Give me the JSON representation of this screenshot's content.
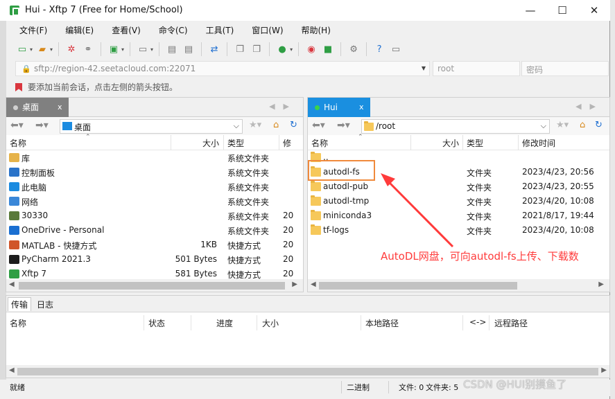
{
  "window": {
    "title": "Hui - Xftp 7 (Free for Home/School)",
    "minimize": "—",
    "maximize": "☐",
    "close": "✕"
  },
  "menu": [
    "文件(F)",
    "编辑(E)",
    "查看(V)",
    "命令(C)",
    "工具(T)",
    "窗口(W)",
    "帮助(H)"
  ],
  "address": {
    "url": "sftp://region-42.seetacloud.com:22071",
    "user_placeholder": "root",
    "password_placeholder": "密码"
  },
  "hint": "要添加当前会话，点击左侧的箭头按钮。",
  "left_pane": {
    "tab": "桌面",
    "tab_close": "x",
    "path": "桌面",
    "columns": [
      "名称",
      "大小",
      "类型",
      "修"
    ],
    "rows": [
      {
        "name": "库",
        "size": "",
        "type": "系统文件夹",
        "modified": "",
        "icon": "library-icon",
        "color": "#e6b34a"
      },
      {
        "name": "控制面板",
        "size": "",
        "type": "系统文件夹",
        "modified": "",
        "icon": "control-panel-icon",
        "color": "#2a73c9"
      },
      {
        "name": "此电脑",
        "size": "",
        "type": "系统文件夹",
        "modified": "",
        "icon": "computer-icon",
        "color": "#1b8be0"
      },
      {
        "name": "网络",
        "size": "",
        "type": "系统文件夹",
        "modified": "",
        "icon": "network-icon",
        "color": "#3a87d8"
      },
      {
        "name": "30330",
        "size": "",
        "type": "系统文件夹",
        "modified": "20",
        "icon": "user-icon",
        "color": "#5a7a3a"
      },
      {
        "name": "OneDrive - Personal",
        "size": "",
        "type": "系统文件夹",
        "modified": "20",
        "icon": "cloud-icon",
        "color": "#1a6fd1"
      },
      {
        "name": "MATLAB - 快捷方式",
        "size": "1KB",
        "type": "快捷方式",
        "modified": "20",
        "icon": "matlab-icon",
        "color": "#d0552a"
      },
      {
        "name": "PyCharm 2021.3",
        "size": "501 Bytes",
        "type": "快捷方式",
        "modified": "20",
        "icon": "pycharm-icon",
        "color": "#1d1d1d"
      },
      {
        "name": "Xftp 7",
        "size": "581 Bytes",
        "type": "快捷方式",
        "modified": "20",
        "icon": "xftp-icon",
        "color": "#2f9e44"
      }
    ]
  },
  "right_pane": {
    "tab": "Hui",
    "tab_close": "x",
    "path": "/root",
    "columns": [
      "名称",
      "大小",
      "类型",
      "修改时间"
    ],
    "rows": [
      {
        "name": "..",
        "size": "",
        "type": "",
        "modified": ""
      },
      {
        "name": "autodl-fs",
        "size": "",
        "type": "文件夹",
        "modified": "2023/4/23, 20:56"
      },
      {
        "name": "autodl-pub",
        "size": "",
        "type": "文件夹",
        "modified": "2023/4/23, 20:55"
      },
      {
        "name": "autodl-tmp",
        "size": "",
        "type": "文件夹",
        "modified": "2023/4/20, 10:08"
      },
      {
        "name": "miniconda3",
        "size": "",
        "type": "文件夹",
        "modified": "2021/8/17, 19:44"
      },
      {
        "name": "tf-logs",
        "size": "",
        "type": "文件夹",
        "modified": "2023/4/20, 10:08"
      }
    ]
  },
  "transfer": {
    "tabs": [
      "传输",
      "日志"
    ],
    "columns": [
      "名称",
      "状态",
      "进度",
      "大小",
      "本地路径",
      "<->",
      "远程路径"
    ]
  },
  "status": {
    "left": "就绪",
    "mode": "二进制",
    "files": "文件: 0",
    "folders": "文件夹: 5"
  },
  "annotation": "AutoDL网盘，可向autodl-fs上传、下载数",
  "watermark": "CSDN @HUI别摸鱼了",
  "colors": {
    "left_tab_bg": "#808080",
    "right_tab_bg": "#1a8fe0",
    "annotation": "#ff3b3b",
    "highlight": "#f08a3c"
  }
}
